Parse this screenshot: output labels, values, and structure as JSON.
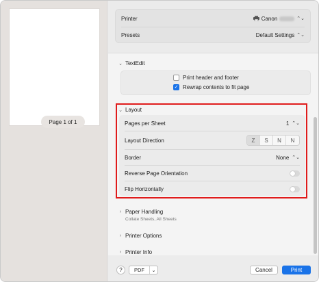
{
  "preview": {
    "page_label": "Page 1 of 1"
  },
  "top": {
    "printer_label": "Printer",
    "printer_value": "Canon",
    "presets_label": "Presets",
    "presets_value": "Default Settings"
  },
  "textedit": {
    "title": "TextEdit",
    "options": [
      {
        "label": "Print header and footer",
        "checked": false
      },
      {
        "label": "Rewrap contents to fit page",
        "checked": true
      }
    ]
  },
  "layout": {
    "title": "Layout",
    "pages_per_sheet_label": "Pages per Sheet",
    "pages_per_sheet_value": "1",
    "layout_direction_label": "Layout Direction",
    "directions": [
      "Z",
      "S",
      "N",
      "N"
    ],
    "border_label": "Border",
    "border_value": "None",
    "reverse_label": "Reverse Page Orientation",
    "flip_label": "Flip Horizontally"
  },
  "sections": {
    "paper_handling": "Paper Handling",
    "paper_handling_sub": "Collate Sheets, All Sheets",
    "printer_options": "Printer Options",
    "printer_info": "Printer Info"
  },
  "footer": {
    "help": "?",
    "pdf": "PDF",
    "cancel": "Cancel",
    "print": "Print"
  },
  "colors": {
    "accent": "#1a73e8",
    "highlight_frame": "#e01b1b"
  }
}
